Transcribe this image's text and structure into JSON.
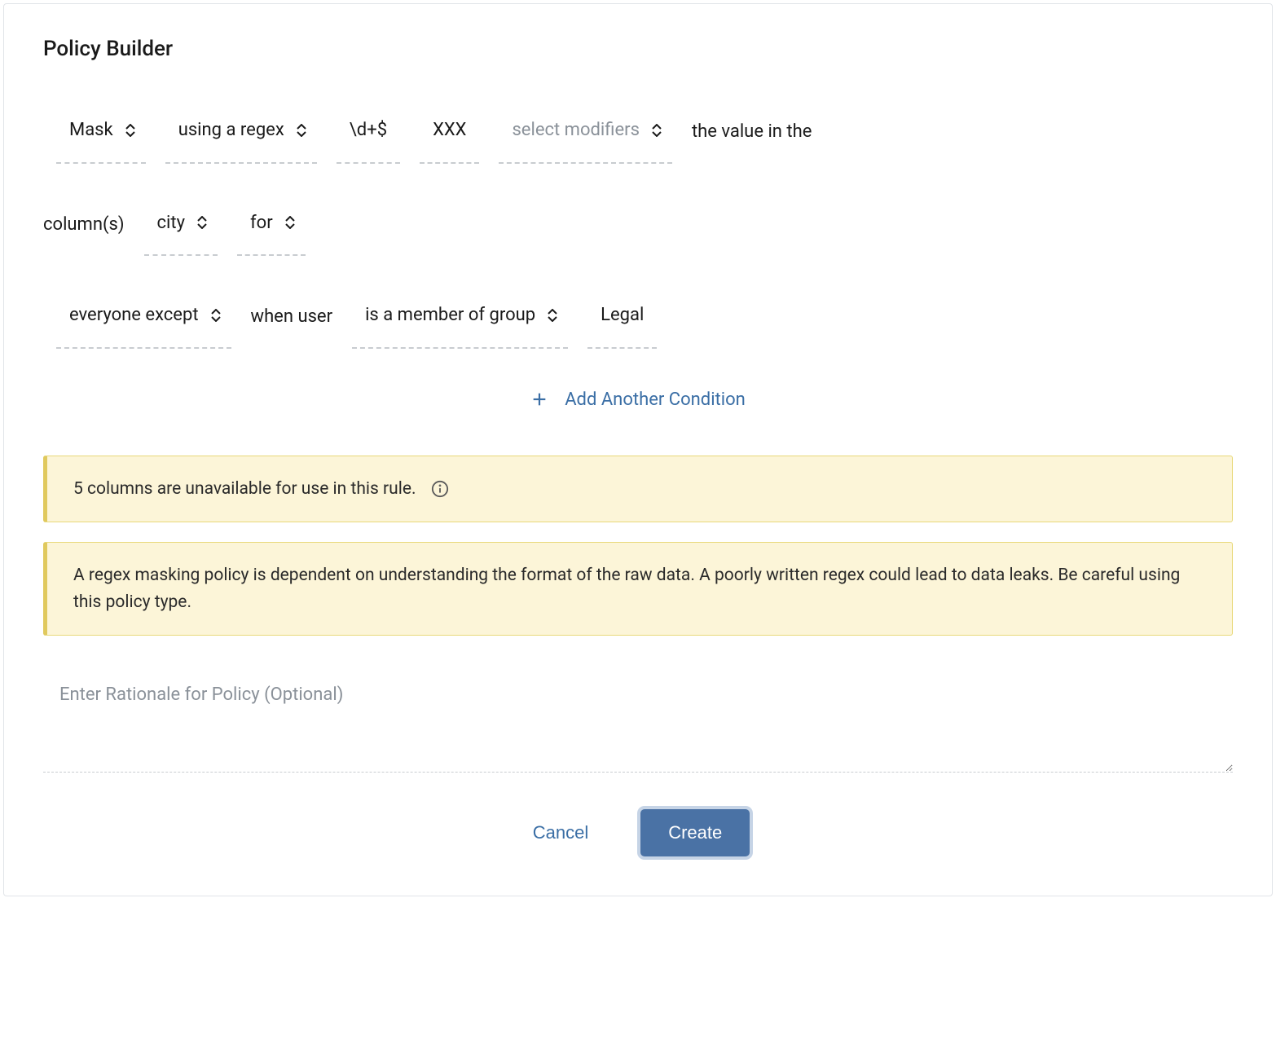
{
  "title": "Policy Builder",
  "rule": {
    "action": "Mask",
    "method": "using a regex",
    "regex_pattern": "\\d+$",
    "replacement": "XXX",
    "modifiers_placeholder": "select modifiers",
    "text_value_in": "the value in the",
    "text_columns": "column(s)",
    "columns_value": "city",
    "scope": "for",
    "apply_to": "everyone except",
    "text_when_user": "when user",
    "condition_type": "is a member of group",
    "condition_value": "Legal"
  },
  "add_condition_label": "Add Another Condition",
  "alerts": {
    "unavailable_columns": "5 columns are unavailable for use in this rule.",
    "regex_warning": "A regex masking policy is dependent on understanding the format of the raw data. A poorly written regex could lead to data leaks. Be careful using this policy type."
  },
  "rationale": {
    "placeholder": "Enter Rationale for Policy (Optional)",
    "value": ""
  },
  "actions": {
    "cancel": "Cancel",
    "create": "Create"
  }
}
